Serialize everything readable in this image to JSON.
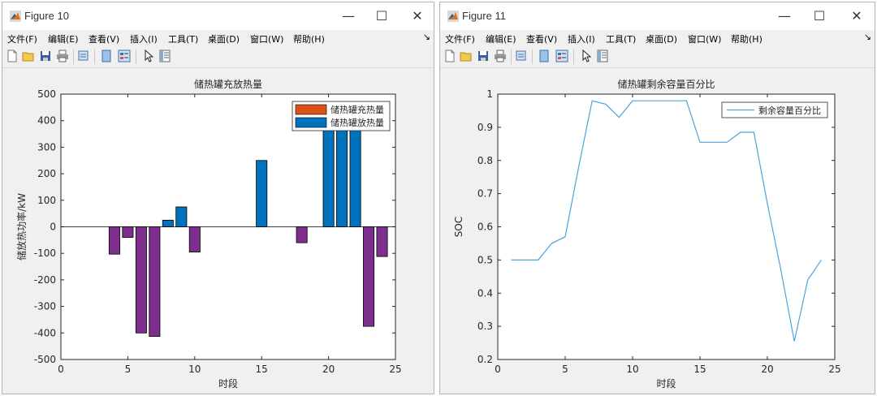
{
  "windows": [
    {
      "title": "Figure 10",
      "menu": [
        "文件(F)",
        "编辑(E)",
        "查看(V)",
        "插入(I)",
        "工具(T)",
        "桌面(D)",
        "窗口(W)",
        "帮助(H)"
      ],
      "menu_overflow": "↘"
    },
    {
      "title": "Figure 11",
      "menu": [
        "文件(F)",
        "编辑(E)",
        "查看(V)",
        "插入(I)",
        "工具(T)",
        "桌面(D)",
        "窗口(W)",
        "帮助(H)"
      ],
      "menu_overflow": "↘"
    }
  ],
  "window_controls": {
    "minimize": "—",
    "maximize": "☐",
    "close": "✕"
  },
  "toolbar_icons": [
    "new-file-icon",
    "open-folder-icon",
    "save-icon",
    "print-icon",
    "print-preview-icon",
    "link-plot-icon",
    "insert-legend-icon",
    "pointer-icon",
    "property-editor-icon"
  ],
  "colors": {
    "charge": "#D95319",
    "discharge": "#0072BD",
    "net": "#7E2F8E",
    "soc_line": "#4DA3D9",
    "plot_bg": "#ffffff",
    "figure_bg": "#f0f0f0"
  },
  "chart_data": [
    {
      "type": "bar",
      "title": "储热罐充放热量",
      "xlabel": "时段",
      "ylabel": "储放热功率/kW",
      "xlim": [
        0,
        25
      ],
      "ylim": [
        -500,
        500
      ],
      "xticks": [
        0,
        5,
        10,
        15,
        20,
        25
      ],
      "yticks": [
        -500,
        -400,
        -300,
        -200,
        -100,
        0,
        100,
        200,
        300,
        400,
        500
      ],
      "legend": {
        "position": "top-right",
        "entries": [
          "储热罐充热量",
          "储热罐放热量"
        ]
      },
      "x": [
        1,
        2,
        3,
        4,
        5,
        6,
        7,
        8,
        9,
        10,
        11,
        12,
        13,
        14,
        15,
        16,
        17,
        18,
        19,
        20,
        21,
        22,
        23,
        24
      ],
      "series": [
        {
          "name": "储热罐充热量",
          "color": "#D95319",
          "values": [
            0,
            0,
            0,
            0,
            0,
            0,
            0,
            0,
            0,
            0,
            0,
            0,
            0,
            0,
            0,
            0,
            0,
            0,
            0,
            0,
            0,
            0,
            0,
            0
          ]
        },
        {
          "name": "储热罐放热量",
          "color": "#0072BD",
          "values": [
            0,
            0,
            0,
            0,
            0,
            0,
            0,
            25,
            75,
            0,
            0,
            0,
            0,
            0,
            250,
            0,
            0,
            0,
            0,
            380,
            380,
            380,
            0,
            0
          ]
        },
        {
          "name": "",
          "color": "#7E2F8E",
          "values": [
            0,
            0,
            0,
            -103,
            -40,
            -400,
            -413,
            0,
            0,
            -95,
            0,
            0,
            0,
            0,
            0,
            0,
            0,
            -60,
            0,
            0,
            0,
            0,
            -375,
            -112
          ]
        }
      ]
    },
    {
      "type": "line",
      "title": "储热罐剩余容量百分比",
      "xlabel": "时段",
      "ylabel": "SOC",
      "xlim": [
        0,
        25
      ],
      "ylim": [
        0.2,
        1
      ],
      "xticks": [
        0,
        5,
        10,
        15,
        20,
        25
      ],
      "yticks": [
        0.2,
        0.3,
        0.4,
        0.5,
        0.6,
        0.7,
        0.8,
        0.9,
        1
      ],
      "legend": {
        "position": "top-right",
        "entries": [
          "剩余容量百分比"
        ]
      },
      "series": [
        {
          "name": "剩余容量百分比",
          "color": "#4DA3D9",
          "x": [
            1,
            2,
            3,
            4,
            5,
            6,
            7,
            8,
            9,
            10,
            11,
            12,
            13,
            14,
            15,
            16,
            17,
            18,
            19,
            20,
            21,
            22,
            23,
            24
          ],
          "values": [
            0.5,
            0.5,
            0.5,
            0.55,
            0.57,
            0.78,
            0.98,
            0.97,
            0.93,
            0.98,
            0.98,
            0.98,
            0.98,
            0.98,
            0.855,
            0.855,
            0.855,
            0.885,
            0.885,
            0.67,
            0.47,
            0.255,
            0.44,
            0.5
          ]
        }
      ]
    }
  ]
}
